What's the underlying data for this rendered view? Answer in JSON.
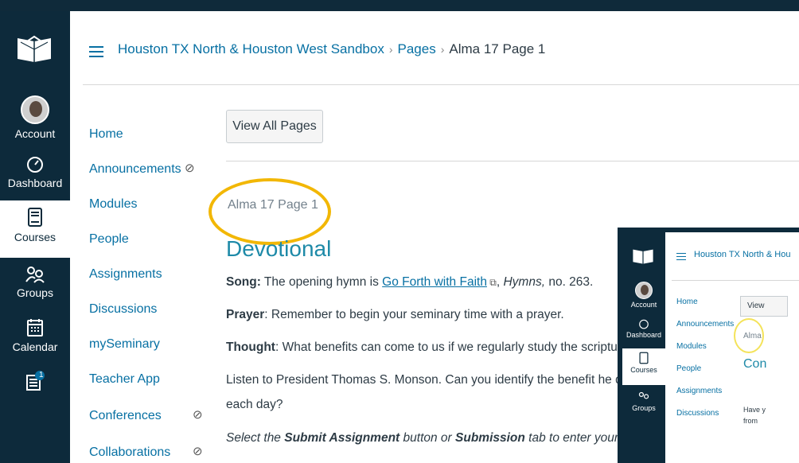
{
  "global_nav": {
    "items": [
      {
        "label": "Account",
        "icon": "avatar"
      },
      {
        "label": "Dashboard",
        "icon": "dashboard-icon"
      },
      {
        "label": "Courses",
        "icon": "courses-icon",
        "active": true
      },
      {
        "label": "Groups",
        "icon": "groups-icon"
      },
      {
        "label": "Calendar",
        "icon": "calendar-icon"
      },
      {
        "label": "",
        "icon": "inbox-icon",
        "badge": "1"
      }
    ]
  },
  "header": {
    "crumb_course": "Houston TX North & Houston West Sandbox",
    "crumb_pages": "Pages",
    "crumb_current": "Alma 17 Page 1"
  },
  "course_nav": {
    "items": [
      {
        "label": "Home"
      },
      {
        "label": "Announcements",
        "hidden": true
      },
      {
        "label": "Modules"
      },
      {
        "label": "People"
      },
      {
        "label": "Assignments"
      },
      {
        "label": "Discussions"
      },
      {
        "label": "mySeminary"
      },
      {
        "label": "Teacher App"
      },
      {
        "label": "Conferences",
        "hidden": true
      },
      {
        "label": "Collaborations",
        "hidden": true
      }
    ]
  },
  "content": {
    "view_all_button": "View All Pages",
    "page_title": "Alma 17 Page 1",
    "heading": "Devotional",
    "song_label": "Song:",
    "song_text_a": " The opening hymn is ",
    "song_link": "Go Forth with Faith",
    "song_text_b": ", ",
    "song_book": "Hymns,",
    "song_text_c": " no. 263.",
    "prayer_label": "Prayer",
    "prayer_text": ": Remember to begin your seminary time with a prayer.",
    "thought_label": "Thought",
    "thought_text": ": What benefits can come to us if we regularly study the scripture",
    "listen_line1": "Listen to President Thomas S. Monson. Can you identify the benefit he de",
    "listen_line2": "each day?",
    "select_a": "Select the ",
    "select_b": "Submit Assignment",
    "select_c": " button or ",
    "select_d": "Submission",
    "select_e": " tab to enter your respor"
  },
  "overlay": {
    "crumb": "Houston TX North & Hou",
    "nav": [
      "Account",
      "Dashboard",
      "Courses",
      "Groups"
    ],
    "course_nav": [
      "Home",
      "Announcements",
      "Modules",
      "People",
      "Assignments",
      "Discussions"
    ],
    "button": "View",
    "page_title": "Alma",
    "heading": "Con",
    "text1": "Have y",
    "text2": "from"
  },
  "colors": {
    "nav_bg": "#0d2a3b",
    "link": "#0770a3",
    "heading": "#1e8aa8",
    "highlight": "#f2b705"
  }
}
